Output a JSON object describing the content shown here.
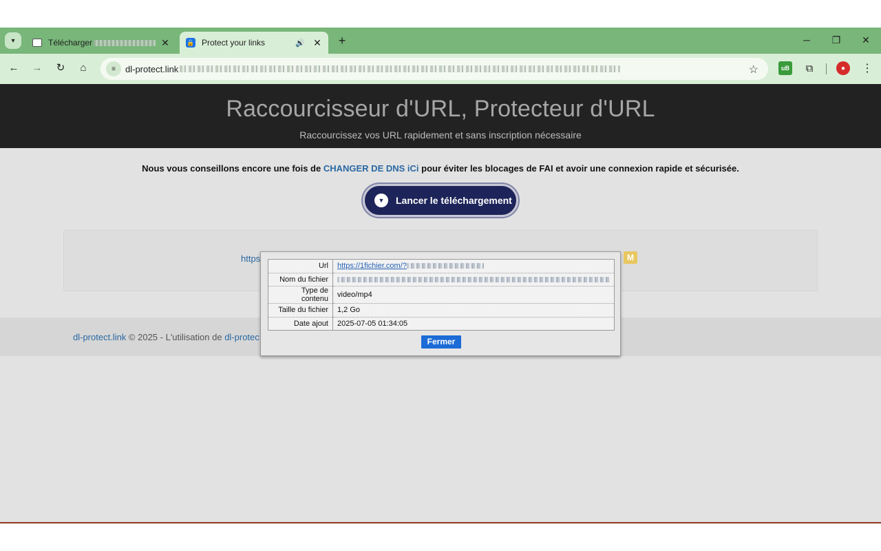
{
  "browser": {
    "tabs": [
      {
        "title": "Télécharger",
        "active": false
      },
      {
        "title": "Protect your links",
        "active": true
      }
    ],
    "new_tab_label": "+",
    "url_host": "dl-protect.link",
    "accent_color": "#78b679",
    "icons": {
      "tab_search": "chevron-down-icon",
      "back": "back-arrow-icon",
      "forward": "forward-arrow-icon",
      "reload": "reload-icon",
      "home": "home-icon",
      "bookmark": "star-icon",
      "extensions": "puzzle-icon",
      "menu": "kebab-menu-icon"
    }
  },
  "page": {
    "header_title": "Raccourcisseur d'URL, Protecteur d'URL",
    "header_subtitle": "Raccourcissez vos URL rapidement et sans inscription nécessaire",
    "advice_before": "Nous vous conseillons encore une fois de ",
    "advice_link": "CHANGER DE DNS iCi",
    "advice_after": " pour éviter les blocages de FAI et avoir une connexion rapide et sécurisée.",
    "download_button": "Lancer le téléchargement",
    "panel_link_prefix": "https",
    "panel_badge": "M",
    "footer_site": "dl-protect.link",
    "footer_text": " © 2025 - L'utilisation de ",
    "footer_link2": "dl-protec"
  },
  "modal": {
    "rows": [
      {
        "label": "Url",
        "value": "https://1fichier.com/?"
      },
      {
        "label": "Nom du fichier",
        "value": ""
      },
      {
        "label": "Type de contenu",
        "value": "video/mp4"
      },
      {
        "label": "Taille du fichier",
        "value": "1,2 Go"
      },
      {
        "label": "Date ajout",
        "value": "2025-07-05 01:34:05"
      }
    ],
    "close_label": "Fermer"
  }
}
